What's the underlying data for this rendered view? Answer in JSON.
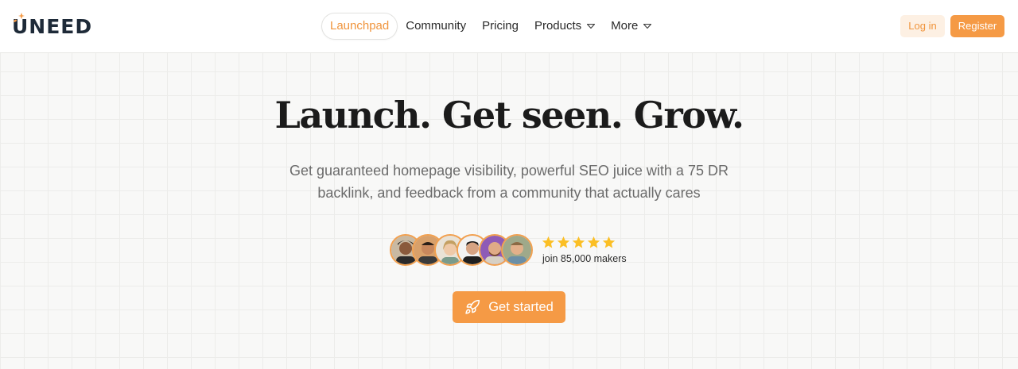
{
  "brand": {
    "name": "UNEED",
    "accent": "#f59a45"
  },
  "nav": {
    "items": [
      {
        "label": "Launchpad",
        "active": true
      },
      {
        "label": "Community"
      },
      {
        "label": "Pricing"
      },
      {
        "label": "Products",
        "dropdown": true
      },
      {
        "label": "More",
        "dropdown": true
      }
    ]
  },
  "auth": {
    "login": "Log in",
    "register": "Register"
  },
  "hero": {
    "title": "Launch. Get seen. Grow.",
    "subtitle": "Get guaranteed homepage visibility, powerful SEO juice with a 75 DR backlink, and feedback from a community that actually cares",
    "rating_stars": 5,
    "social_proof": "join 85,000 makers",
    "cta": "Get started",
    "cta_icon": "rocket-icon"
  }
}
